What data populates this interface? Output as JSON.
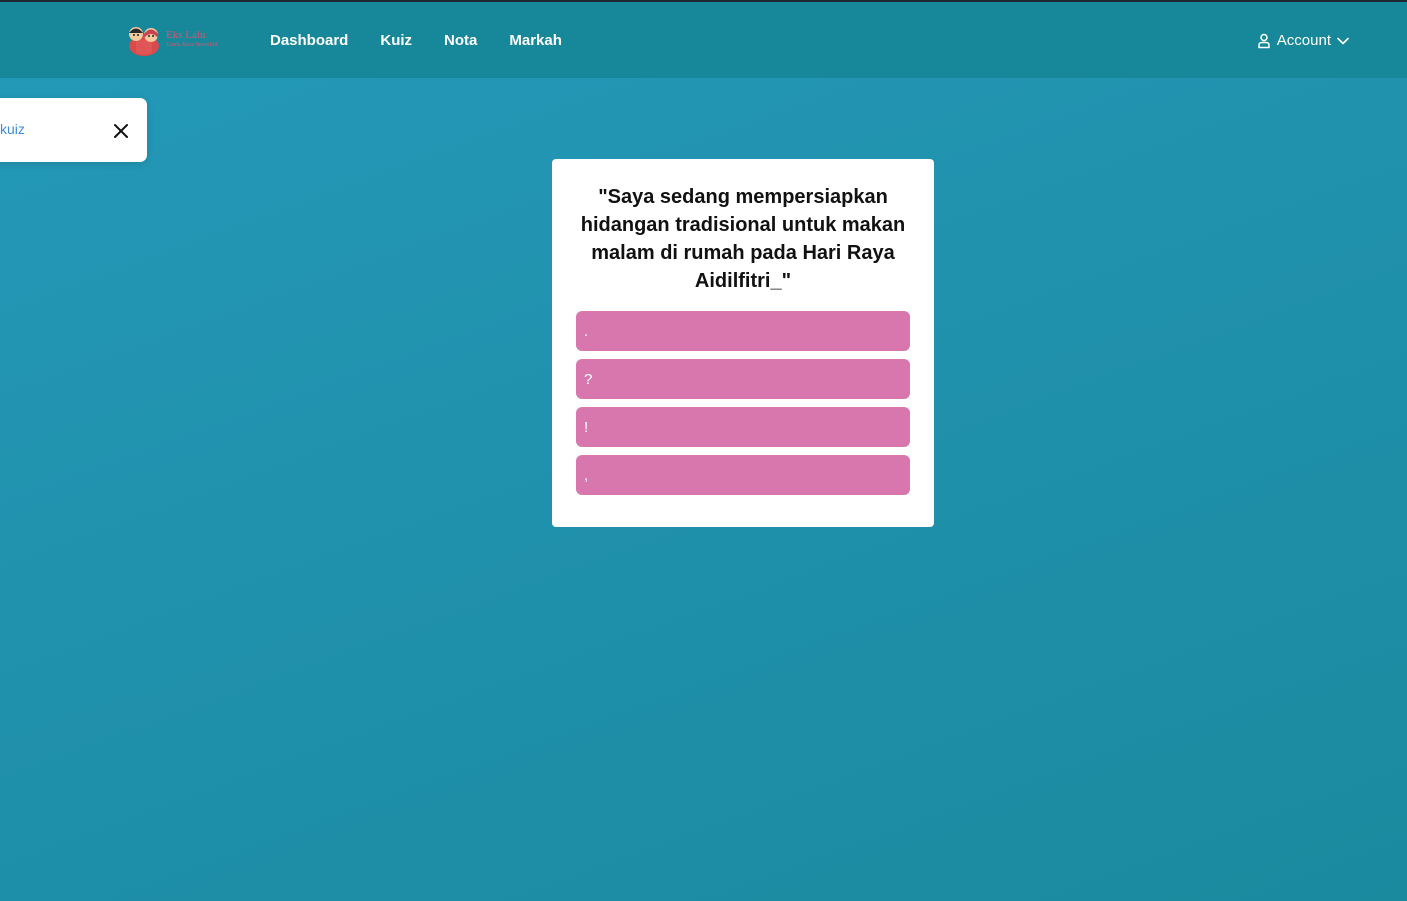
{
  "header": {
    "logo": {
      "title": "Eks Lalu",
      "subtitle": "Tanda Baca Interaktif"
    },
    "nav": [
      {
        "label": "Dashboard"
      },
      {
        "label": "Kuiz"
      },
      {
        "label": "Nota"
      },
      {
        "label": "Markah"
      }
    ],
    "account": {
      "label": "Account",
      "icon": "user-icon",
      "dropdown_icon": "chevron-down-icon"
    }
  },
  "toast": {
    "text": "kuiz",
    "close_icon": "close-icon"
  },
  "quiz": {
    "question": "\"Saya sedang mempersiapkan hidangan tradisional untuk makan malam di rumah pada Hari Raya Aidilfitri_\"",
    "options": [
      {
        "label": "."
      },
      {
        "label": "?"
      },
      {
        "label": "!"
      },
      {
        "label": ","
      }
    ]
  },
  "colors": {
    "background": "#2196b3",
    "navbar": "#17879a",
    "option": "#d876ae",
    "toast_text": "#3f8bd6"
  }
}
